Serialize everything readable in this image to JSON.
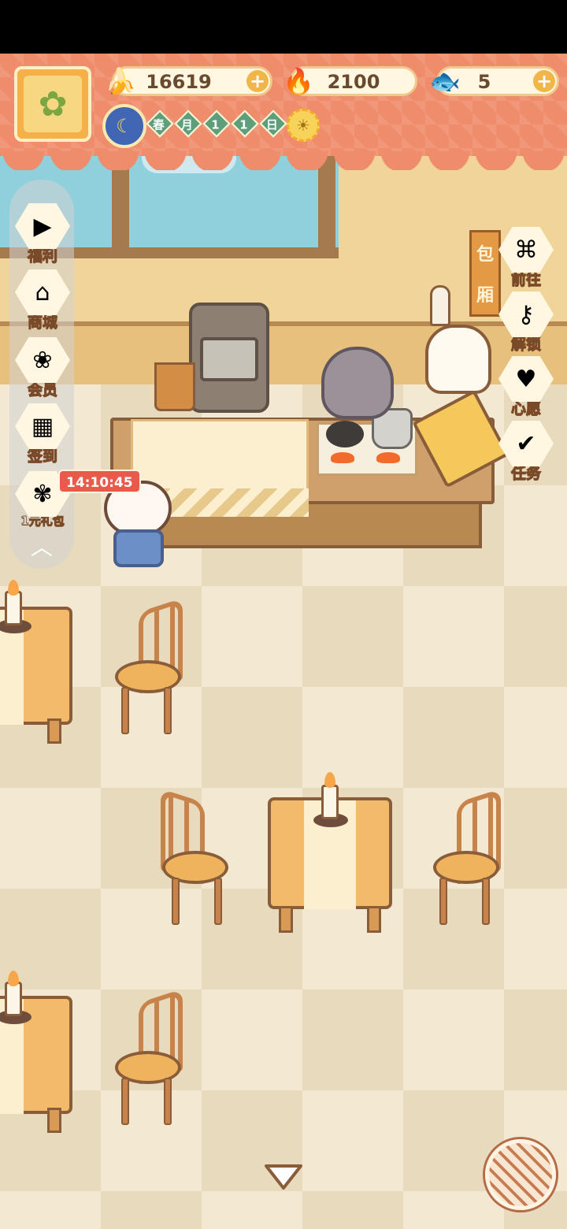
{
  "resources": {
    "banana": {
      "value": "16619",
      "icon": "banana-icon"
    },
    "fire_pepper": {
      "value": "2100",
      "icon": "fire-pepper-icon"
    },
    "fish": {
      "value": "5",
      "icon": "blue-fish-icon"
    },
    "plus_label": "+"
  },
  "calendar": {
    "season": "春",
    "month_label": "月",
    "month": "1",
    "day": "1",
    "day_label": "日"
  },
  "left_menu": [
    {
      "label": "福利",
      "icon": "tv-icon"
    },
    {
      "label": "商城",
      "icon": "shop-icon"
    },
    {
      "label": "会员",
      "icon": "flower-icon"
    },
    {
      "label": "签到",
      "icon": "calendar-icon"
    },
    {
      "label": "1元礼包",
      "icon": "gift-bouquet-icon"
    }
  ],
  "timer": "14:10:45",
  "right_menu": [
    {
      "label": "前往",
      "icon": "scroll-map-icon"
    },
    {
      "label": "解锁",
      "icon": "key-icon"
    },
    {
      "label": "心愿",
      "icon": "heart-book-icon"
    },
    {
      "label": "任务",
      "icon": "task-board-icon"
    }
  ],
  "sign": {
    "char1": "包",
    "char2": "厢"
  },
  "colors": {
    "hud": "#ef8c6b",
    "wall": "#f1d49a",
    "floor": "#f3e8d2",
    "wood": "#8a5d3a"
  }
}
